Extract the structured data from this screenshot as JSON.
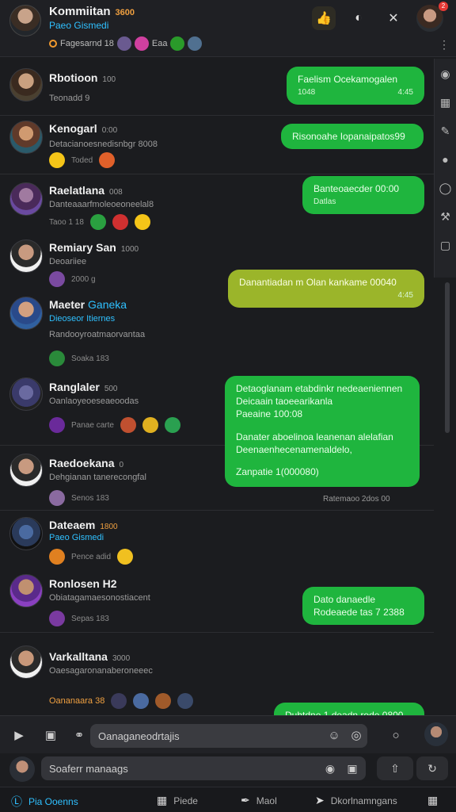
{
  "header": {
    "title": "Kommiitan",
    "title_tag": "3600",
    "subtitle": "Paeo Gismedi",
    "members_text": "Fagesarnd 18",
    "members_extra": "Eaa"
  },
  "feed": [
    {
      "name": "Rbotioon",
      "meta": "100",
      "line2": "Teonadd 9",
      "line3": "",
      "bubble": {
        "text": "Faelism Ocekamogalen",
        "ts_left": "1048",
        "ts_right": "4:45"
      }
    },
    {
      "name": "Kenogarl",
      "meta": "0:00",
      "line2": "Detacianoesnedisnbgr 8008",
      "line3": "Toded",
      "bubble": {
        "text": "Risonoahe Iopanaipatos99",
        "ts_left": "",
        "ts_right": ""
      }
    },
    {
      "name": "Raelatlana",
      "meta": "008",
      "line2": "Danteaaarfmoleoeoneelal8",
      "line3": "Taoo 1 18",
      "bubble": {
        "text": "Banteoaecder 00:00",
        "ts_left": "Datlas",
        "ts_right": ""
      }
    },
    {
      "name": "Remiary San",
      "meta": "1000",
      "line2": "Deoariiee",
      "line3": "2000 g",
      "bubble": {
        "text": "Danantiadan m Olan kankame 00040",
        "ts_left": "",
        "ts_right": "4:45"
      }
    },
    {
      "name": "Maeter",
      "name_extra": "Ganeka",
      "line2": "Dieoseor Itiernes",
      "line2b": "Randooyroatmaorvantaa",
      "line3": "Soaka 183",
      "bubble": null
    },
    {
      "name": "Ranglaler",
      "meta": "500",
      "line2": "Oanlaoyeoeseaeoodas",
      "line3": "Panae carte",
      "bubble": {
        "lines": [
          "Detaoglanam etabdinkr nedeaeniennen",
          "Deicaain taoeearikanla",
          "Paeaine 100:08",
          "",
          "Danater aboelinoa leanenan alelafian",
          "Deenaenhecenamenaldelo,",
          "",
          "Zanpatie 1(000080)"
        ],
        "under": "Ratemaoo 2dos 00"
      }
    },
    {
      "name": "Raedoekana",
      "meta": "0",
      "line2": "Dehgianan tanerecongfal",
      "line3": "Senos 183",
      "bubble": null
    },
    {
      "name": "Dateaem",
      "meta": "1800",
      "line2": "Paeo Gismedi",
      "line3": "Pence adid",
      "bubble": null
    },
    {
      "name": "Ronlosen H2",
      "meta": "",
      "line2": "Obiatagamaesonostiacent",
      "line3": "Sepas 183",
      "bubble": {
        "text": "Dato danaedle",
        "ts_left": "Rodeaede tas 7 2388",
        "ts_right": ""
      }
    },
    {
      "name": "Varkalltana",
      "meta": "3000",
      "line2": "Oaesagaronanaberoneeec",
      "line3": "Oananaara 38",
      "bubble": {
        "text": "Duhtdne 1 deadn rode 0800",
        "ts_left": "",
        "ts_right": ""
      }
    }
  ],
  "composer": {
    "placeholder": "Oanaganeodrtajis"
  },
  "search": {
    "placeholder": "Soaferr manaags"
  },
  "nav": {
    "item1": "Pia Ooenns",
    "item2": "Piede",
    "item3": "Maol",
    "item4": "Dkorlnamngans"
  },
  "colors": {
    "bubble_green": "#1fb53e",
    "bubble_lime": "#9bb52a",
    "accent_blue": "#2fc0ff",
    "bg": "#1b1c1f"
  }
}
